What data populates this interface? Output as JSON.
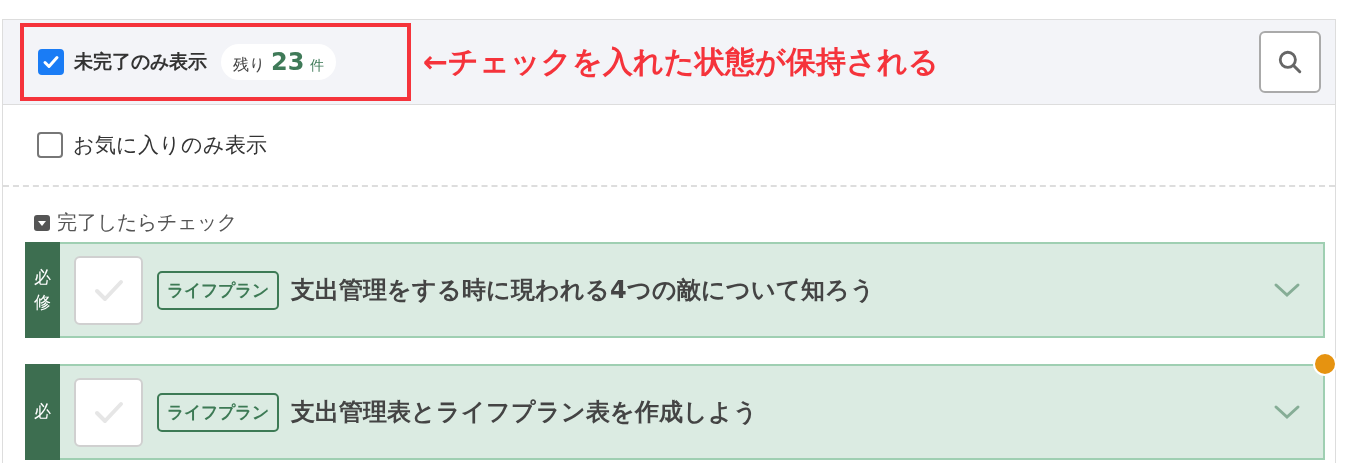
{
  "filter_bar": {
    "incomplete_only": {
      "label": "未完了のみ表示",
      "checked": true
    },
    "remaining": {
      "prefix": "残り",
      "count": "23",
      "unit": "件"
    },
    "annotation": "←チェックを入れた状態が保持される"
  },
  "favorites_only": {
    "label": "お気に入りのみ表示",
    "checked": false
  },
  "section": {
    "label": "完了したらチェック",
    "expanded": true
  },
  "tasks": [
    {
      "required_label": "必修",
      "checked": false,
      "tag": "ライフプラン",
      "title": "支出管理をする時に現われる4つの敵について知ろう",
      "notified": false
    },
    {
      "required_label": "必",
      "checked": false,
      "tag": "ライフプラン",
      "title": "支出管理表とライフプラン表を作成しよう",
      "notified": true
    }
  ]
}
